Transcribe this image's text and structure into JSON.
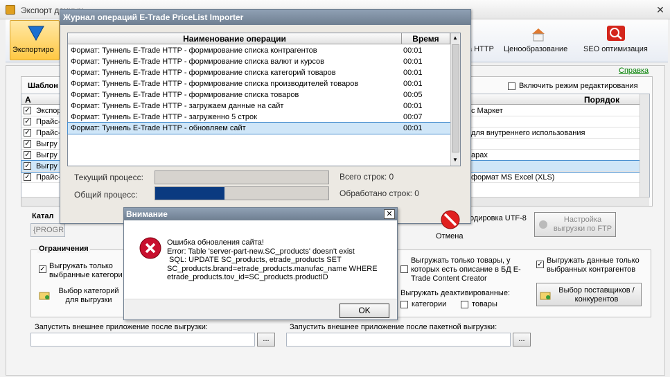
{
  "main": {
    "title": "Экспорт данных",
    "close_glyph": "✕",
    "ribbon": {
      "export": "Экспортиро",
      "http": "а HTTP",
      "pricing": "Ценообразование",
      "seo": "SEO оптимизация"
    },
    "help_link": "Справка",
    "templates_label": "Шаблон",
    "edit_mode_label": "Включить режим редактирования",
    "grid": {
      "col_a": "А",
      "col_order": "Порядок",
      "rows_left": [
        "Экспор",
        "Прайс-",
        "Прайс-",
        "Выгру",
        "Выгру",
        "Выгру",
        "Прайс-"
      ],
      "rows_right": [
        "с Маркет",
        "",
        "для внутреннего использования",
        "",
        "арах",
        "",
        "формат MS Excel (XLS)"
      ]
    },
    "catalog_label": "Катал",
    "catalog_value": "{PROGR",
    "encoding_label": "одировка UTF-8",
    "ftp_button": "Настройка выгрузки по FTP",
    "restrictions_title": "Ограничения",
    "only_selected_categories": "Выгружать только выбранные категори",
    "select_categories_button": "Выбор категорий для выгрузки",
    "only_with_description": "Выгружать только товары, у которых есть описание в БД E-Trade Content Creator",
    "only_selected_contractors": "Выгружать данные только выбранных контрагентов",
    "deactivated_title": "Выгружать деактивированные:",
    "deactivated_categories": "категории",
    "deactivated_products": "товары",
    "suppliers_button": "Выбор поставщиков / конкурентов",
    "run_external_label": "Запустить внешнее приложение после выгрузки:",
    "run_external_batch_label": "Запустить внешнее приложение после пакетной выгрузки:",
    "browse": "..."
  },
  "journal": {
    "title": "Журнал операций E-Trade PriceList Importer",
    "col_name": "Наименование операции",
    "col_time": "Время",
    "rows": [
      {
        "op": "Формат: Туннель E-Trade HTTP - формирование списка контрагентов",
        "time": "00:01"
      },
      {
        "op": "Формат: Туннель E-Trade HTTP - формирование списка валют и курсов",
        "time": "00:01"
      },
      {
        "op": "Формат: Туннель E-Trade HTTP - формирование списка категорий товаров",
        "time": "00:01"
      },
      {
        "op": "Формат: Туннель E-Trade HTTP - формирование списка производителей товаров",
        "time": "00:01"
      },
      {
        "op": "Формат: Туннель E-Trade HTTP - формирование списка товаров",
        "time": "00:05"
      },
      {
        "op": "Формат: Туннель E-Trade HTTP - загружаем данные на сайт",
        "time": "00:01"
      },
      {
        "op": "Формат: Туннель E-Trade HTTP - загруженно 5 строк",
        "time": "00:07"
      },
      {
        "op": "Формат: Туннель E-Trade HTTP - обновляем сайт",
        "time": "00:01"
      }
    ],
    "current_process_label": "Текущий процесс:",
    "total_process_label": "Общий процесс:",
    "current_progress": 0,
    "total_progress": 0.4,
    "total_rows": "Всего строк: 0",
    "processed_rows": "Обработано строк: 0",
    "cancel": "Отмена"
  },
  "alert": {
    "title": "Внимание",
    "close_glyph": "✕",
    "message_line1": "Ошибка обновления сайта!",
    "message_line2": "Error: Table 'server-part-new.SC_products' doesn't exist",
    "message_line3": " SQL: UPDATE SC_products, etrade_products SET",
    "message_line4": "SC_products.brand=etrade_products.manufac_name WHERE",
    "message_line5": "etrade_products.tov_id=SC_products.productID",
    "ok": "OK"
  },
  "colors": {
    "progress_fill": "#0a3a80",
    "selection": "#cfe6f8",
    "error_red": "#c8102e",
    "link": "#008000"
  }
}
